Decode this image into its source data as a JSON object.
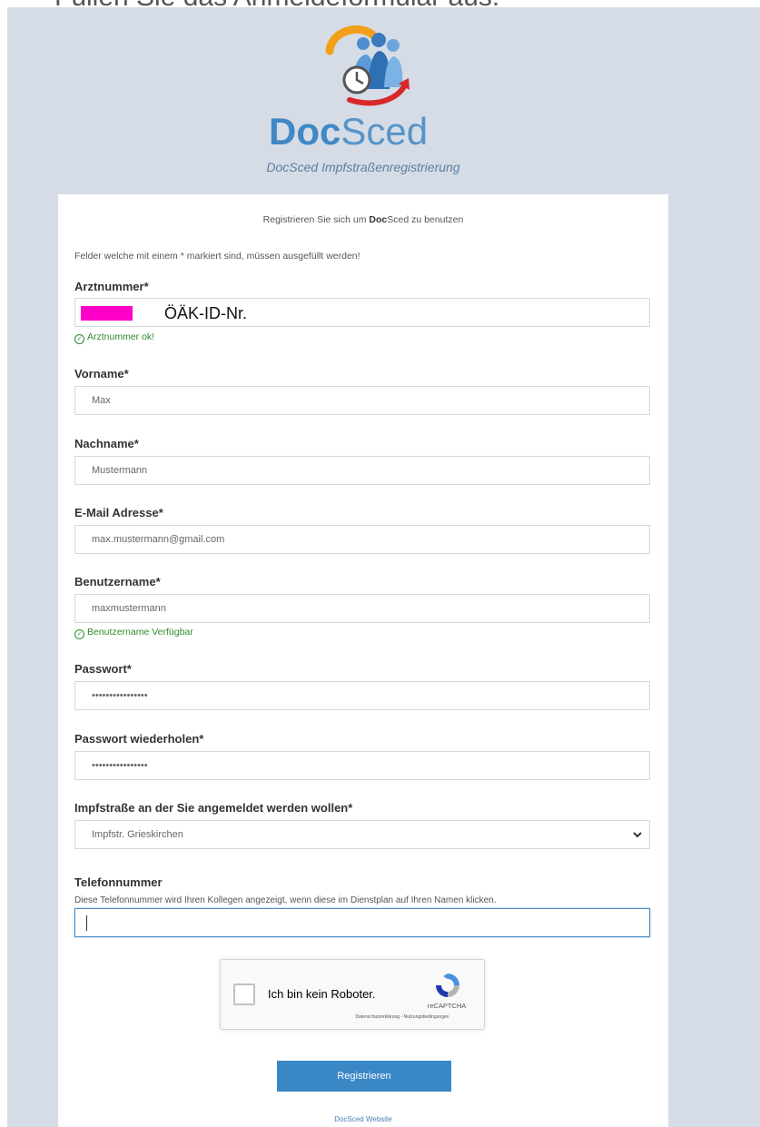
{
  "top_heading": "Füllen Sie das Anmeldeformular aus.",
  "logo": {
    "doc": "Doc",
    "sced": "Sced"
  },
  "subtitle": "DocSced Impfstraßenregistrierung",
  "intro": {
    "pre": "Registrieren Sie sich um ",
    "brand_bold": "Doc",
    "brand_rest": "Sced",
    "post": " zu benutzen"
  },
  "required_note": "Felder welche mit einem * markiert sind, müssen ausgefüllt werden!",
  "fields": {
    "arztnummer": {
      "label": "Arztnummer*",
      "value": "ÖÄK-ID-Nr.",
      "ok": "Arztnummer ok!"
    },
    "vorname": {
      "label": "Vorname*",
      "value": "Max"
    },
    "nachname": {
      "label": "Nachname*",
      "value": "Mustermann"
    },
    "email": {
      "label": "E-Mail Adresse*",
      "value": "max.mustermann@gmail.com"
    },
    "benutzername": {
      "label": "Benutzername*",
      "value": "maxmustermann",
      "ok": "Benutzername Verfügbar"
    },
    "passwort": {
      "label": "Passwort*",
      "value": "••••••••••••••••"
    },
    "passwort_wdh": {
      "label": "Passwort wiederholen*",
      "value": "••••••••••••••••"
    },
    "impfstrasse": {
      "label": "Impfstraße an der Sie angemeldet werden wollen*",
      "value": "Impfstr. Grieskirchen"
    },
    "telefon": {
      "label": "Telefonnummer",
      "help": "Diese Telefonnummer wird Ihren Kollegen angezeigt, wenn diese im Dienstplan auf Ihren Namen klicken.",
      "value": ""
    }
  },
  "recaptcha": {
    "label": "Ich bin kein Roboter.",
    "brand": "reCAPTCHA",
    "links": "Datenschutzerklärung - Nutzungsbedingungen"
  },
  "register_label": "Registrieren",
  "website_link": "DocSced Website",
  "colors": {
    "accent": "#3a87c6",
    "ok": "#2e8b2e",
    "background": "#d6dce5"
  }
}
